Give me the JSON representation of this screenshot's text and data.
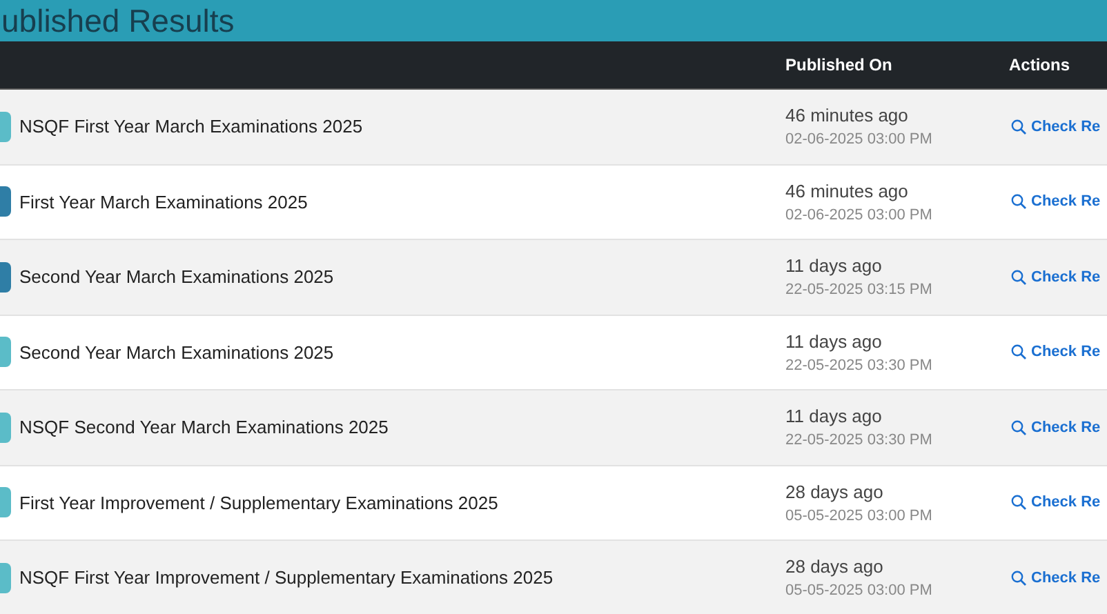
{
  "title": "ublished Results",
  "table": {
    "columns": [
      {
        "label": "Published On"
      },
      {
        "label": "Actions"
      }
    ],
    "rows": [
      {
        "color": "#5bbcc8",
        "name": "NSQF First Year March Examinations 2025",
        "ago": "46 minutes ago",
        "date": "02-06-2025 03:00 PM",
        "action": "Check Re"
      },
      {
        "color": "#2f7ea6",
        "name": "First Year March Examinations 2025",
        "ago": "46 minutes ago",
        "date": "02-06-2025 03:00 PM",
        "action": "Check Re"
      },
      {
        "color": "#2f7ea6",
        "name": "Second Year March Examinations 2025",
        "ago": "11 days ago",
        "date": "22-05-2025 03:15 PM",
        "action": "Check Re"
      },
      {
        "color": "#5bbcc8",
        "name": "Second Year March Examinations 2025",
        "ago": "11 days ago",
        "date": "22-05-2025 03:30 PM",
        "action": "Check Re"
      },
      {
        "color": "#5bbcc8",
        "name": "NSQF Second Year March Examinations 2025",
        "ago": "11 days ago",
        "date": "22-05-2025 03:30 PM",
        "action": "Check Re"
      },
      {
        "color": "#5bbcc8",
        "name": "First Year Improvement / Supplementary Examinations 2025",
        "ago": "28 days ago",
        "date": "05-05-2025 03:00 PM",
        "action": "Check Re"
      },
      {
        "color": "#5bbcc8",
        "name": "NSQF First Year Improvement / Supplementary Examinations 2025",
        "ago": "28 days ago",
        "date": "05-05-2025 03:00 PM",
        "action": "Check Re"
      }
    ]
  }
}
